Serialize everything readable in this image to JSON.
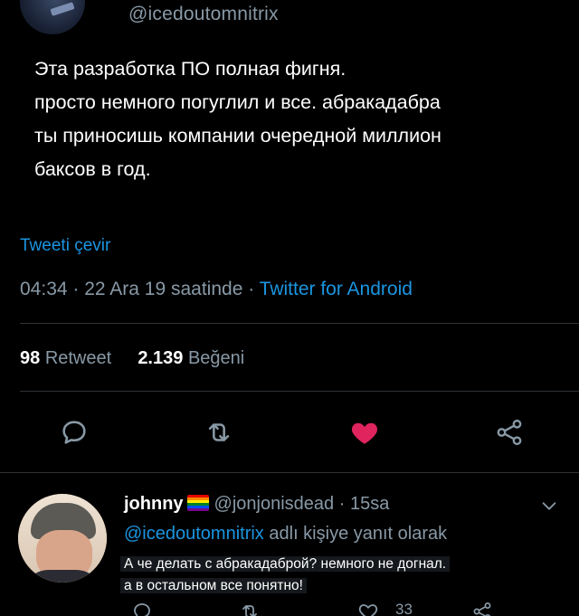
{
  "tweet": {
    "handle": "@icedoutomnitrix",
    "text_lines": [
      "Эта разработка ПО полная фигня.",
      "просто немного погуглил и все. абракадабра",
      "ты приносишь компании очередной миллион",
      "баксов в год."
    ],
    "translate_label": "Tweeti çevir",
    "time": "04:34",
    "date": "22 Ara 19 saatinde",
    "source": "Twitter for Android",
    "retweet_count": "98",
    "retweet_label": "Retweet",
    "like_count": "2.139",
    "like_label": "Beğeni",
    "liked": true
  },
  "reply": {
    "name": "johnny",
    "handle": "@jonjonisdead",
    "age": "15sa",
    "reply_to_mention": "@icedoutomnitrix",
    "reply_to_suffix": "adlı kişiye yanıt olarak",
    "text_lines": [
      "А че делать с абракадаброй? немного не догнал.",
      "а в остальном все понятно!"
    ],
    "like_count": "33"
  },
  "colors": {
    "background": "#000000",
    "text_primary": "#ffffff",
    "text_secondary": "#8899a6",
    "link": "#1b95e0",
    "like_active": "#e0245e",
    "divider": "#2f3336"
  },
  "icons": {
    "reply": "reply-icon",
    "retweet": "retweet-icon",
    "like": "heart-icon",
    "share": "share-icon",
    "menu": "chevron-down-icon",
    "flag": "rainbow-flag-icon"
  }
}
